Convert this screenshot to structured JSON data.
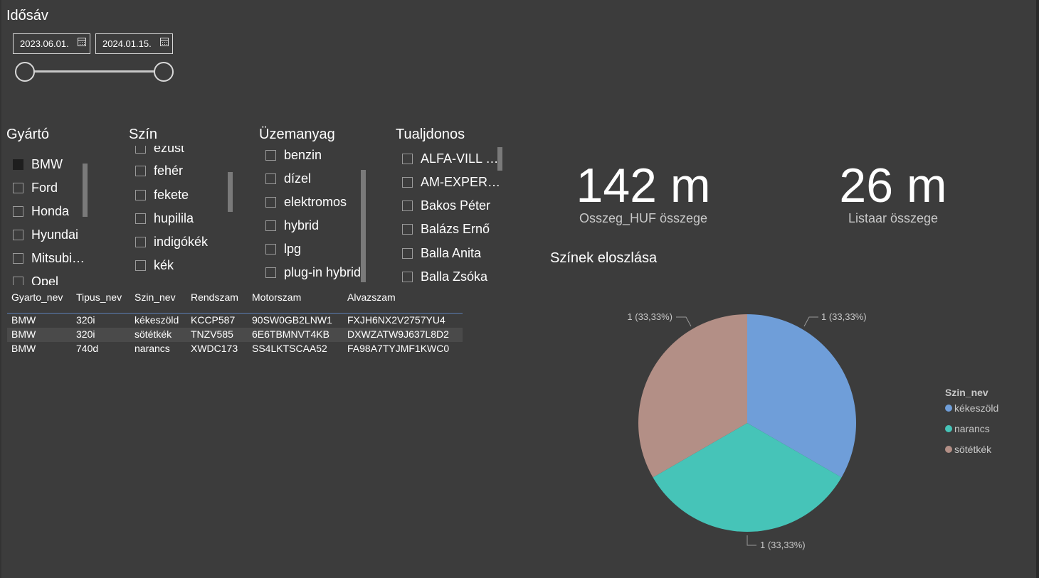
{
  "time_slicer": {
    "title": "Idősáv",
    "start_date": "2023.06.01.",
    "end_date": "2024.01.15."
  },
  "slicers": {
    "gyarto": {
      "title": "Gyártó",
      "items": [
        {
          "label": "BMW",
          "checked": true
        },
        {
          "label": "Ford",
          "checked": false
        },
        {
          "label": "Honda",
          "checked": false
        },
        {
          "label": "Hyundai",
          "checked": false
        },
        {
          "label": "Mitsubi…",
          "checked": false
        },
        {
          "label": "Opel",
          "checked": false
        }
      ]
    },
    "szin": {
      "title": "Szín",
      "items": [
        {
          "label": "ezüst"
        },
        {
          "label": "fehér"
        },
        {
          "label": "fekete"
        },
        {
          "label": "hupilila"
        },
        {
          "label": "indigókék"
        },
        {
          "label": "kék"
        }
      ]
    },
    "uzemanyag": {
      "title": "Üzemanyag",
      "items": [
        {
          "label": "benzin"
        },
        {
          "label": "dízel"
        },
        {
          "label": "elektromos"
        },
        {
          "label": "hybrid"
        },
        {
          "label": "lpg"
        },
        {
          "label": "plug-in hybrid"
        }
      ]
    },
    "tulajdonos": {
      "title": "Tualjdonos",
      "items": [
        {
          "label": "ALFA-VILL …"
        },
        {
          "label": "AM-EXPER…"
        },
        {
          "label": "Bakos Péter"
        },
        {
          "label": "Balázs Ernő"
        },
        {
          "label": "Balla Anita"
        },
        {
          "label": "Balla Zsóka"
        }
      ]
    }
  },
  "table": {
    "columns": [
      "Gyarto_nev",
      "Tipus_nev",
      "Szin_nev",
      "Rendszam",
      "Motorszam",
      "Alvazszam"
    ],
    "rows": [
      [
        "BMW",
        "320i",
        "kékeszöld",
        "KCCP587",
        "90SW0GB2LNW1",
        "FXJH6NX2V2757YU4"
      ],
      [
        "BMW",
        "320i",
        "sötétkék",
        "TNZV585",
        "6E6TBMNVT4KB",
        "DXWZATW9J637L8D2"
      ],
      [
        "BMW",
        "740d",
        "narancs",
        "XWDC173",
        "SS4LKTSCAA52",
        "FA98A7TYJMF1KWC0"
      ]
    ]
  },
  "cards": [
    {
      "value": "142 m",
      "label": "Osszeg_HUF összege"
    },
    {
      "value": "26 m",
      "label": "Listaar összege"
    }
  ],
  "chart_data": {
    "type": "pie",
    "title": "Színek eloszlása",
    "legend_title": "Szin_nev",
    "legend_position": "right",
    "slices": [
      {
        "name": "kékeszöld",
        "value": 1,
        "label": "1 (33,33%)",
        "color": "#6f9ed9"
      },
      {
        "name": "narancs",
        "value": 1,
        "label": "1 (33,33%)",
        "color": "#46c4b8"
      },
      {
        "name": "sötétkék",
        "value": 1,
        "label": "1 (33,33%)",
        "color": "#b38f86"
      }
    ]
  }
}
